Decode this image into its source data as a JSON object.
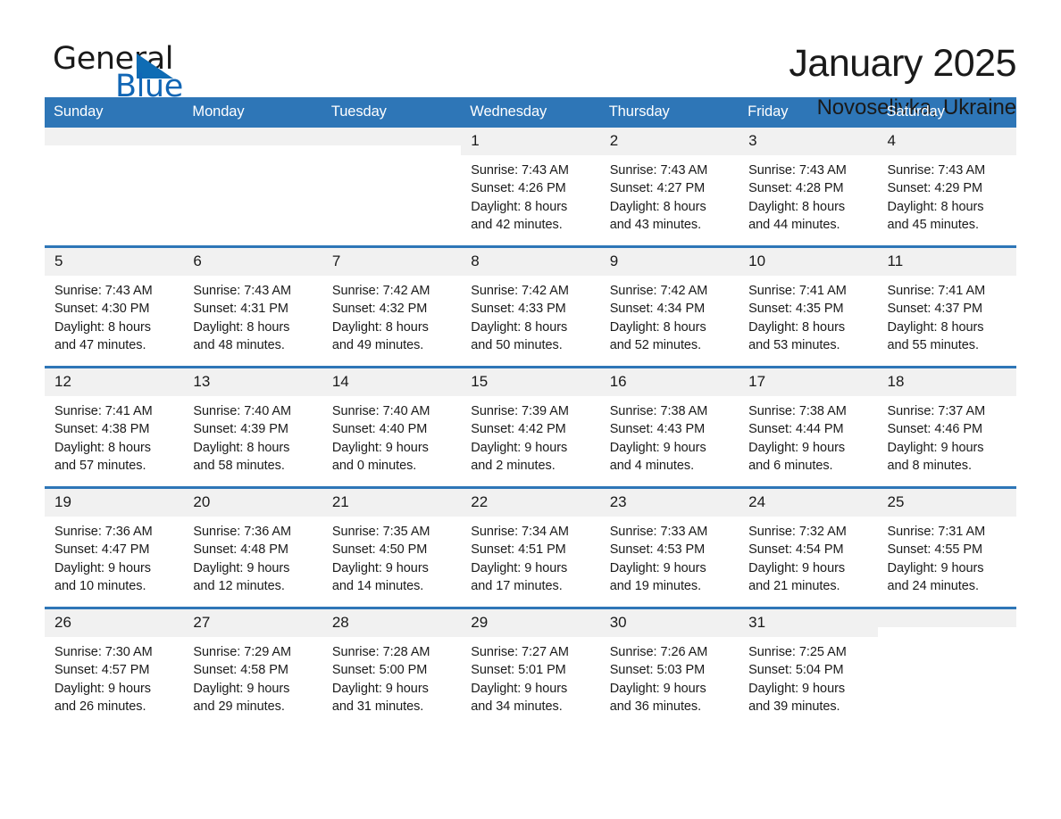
{
  "logo": {
    "word_one": "General",
    "word_two": "Blue",
    "triangle_icon": "triangle-icon"
  },
  "header": {
    "title": "January 2025",
    "location": "Novoselivka, Ukraine"
  },
  "colors": {
    "header_blue": "#2e76b7",
    "daynum_gray": "#f1f1f1",
    "logo_blue": "#1166b5",
    "text": "#1a1a1a"
  },
  "weekday_headers": [
    "Sunday",
    "Monday",
    "Tuesday",
    "Wednesday",
    "Thursday",
    "Friday",
    "Saturday"
  ],
  "weeks": [
    [
      {
        "day": "",
        "empty": true,
        "sunrise": "",
        "sunset": "",
        "daylight_line1": "",
        "daylight_line2": ""
      },
      {
        "day": "",
        "empty": true,
        "sunrise": "",
        "sunset": "",
        "daylight_line1": "",
        "daylight_line2": ""
      },
      {
        "day": "",
        "empty": true,
        "sunrise": "",
        "sunset": "",
        "daylight_line1": "",
        "daylight_line2": ""
      },
      {
        "day": "1",
        "empty": false,
        "sunrise": "Sunrise: 7:43 AM",
        "sunset": "Sunset: 4:26 PM",
        "daylight_line1": "Daylight: 8 hours",
        "daylight_line2": "and 42 minutes."
      },
      {
        "day": "2",
        "empty": false,
        "sunrise": "Sunrise: 7:43 AM",
        "sunset": "Sunset: 4:27 PM",
        "daylight_line1": "Daylight: 8 hours",
        "daylight_line2": "and 43 minutes."
      },
      {
        "day": "3",
        "empty": false,
        "sunrise": "Sunrise: 7:43 AM",
        "sunset": "Sunset: 4:28 PM",
        "daylight_line1": "Daylight: 8 hours",
        "daylight_line2": "and 44 minutes."
      },
      {
        "day": "4",
        "empty": false,
        "sunrise": "Sunrise: 7:43 AM",
        "sunset": "Sunset: 4:29 PM",
        "daylight_line1": "Daylight: 8 hours",
        "daylight_line2": "and 45 minutes."
      }
    ],
    [
      {
        "day": "5",
        "empty": false,
        "sunrise": "Sunrise: 7:43 AM",
        "sunset": "Sunset: 4:30 PM",
        "daylight_line1": "Daylight: 8 hours",
        "daylight_line2": "and 47 minutes."
      },
      {
        "day": "6",
        "empty": false,
        "sunrise": "Sunrise: 7:43 AM",
        "sunset": "Sunset: 4:31 PM",
        "daylight_line1": "Daylight: 8 hours",
        "daylight_line2": "and 48 minutes."
      },
      {
        "day": "7",
        "empty": false,
        "sunrise": "Sunrise: 7:42 AM",
        "sunset": "Sunset: 4:32 PM",
        "daylight_line1": "Daylight: 8 hours",
        "daylight_line2": "and 49 minutes."
      },
      {
        "day": "8",
        "empty": false,
        "sunrise": "Sunrise: 7:42 AM",
        "sunset": "Sunset: 4:33 PM",
        "daylight_line1": "Daylight: 8 hours",
        "daylight_line2": "and 50 minutes."
      },
      {
        "day": "9",
        "empty": false,
        "sunrise": "Sunrise: 7:42 AM",
        "sunset": "Sunset: 4:34 PM",
        "daylight_line1": "Daylight: 8 hours",
        "daylight_line2": "and 52 minutes."
      },
      {
        "day": "10",
        "empty": false,
        "sunrise": "Sunrise: 7:41 AM",
        "sunset": "Sunset: 4:35 PM",
        "daylight_line1": "Daylight: 8 hours",
        "daylight_line2": "and 53 minutes."
      },
      {
        "day": "11",
        "empty": false,
        "sunrise": "Sunrise: 7:41 AM",
        "sunset": "Sunset: 4:37 PM",
        "daylight_line1": "Daylight: 8 hours",
        "daylight_line2": "and 55 minutes."
      }
    ],
    [
      {
        "day": "12",
        "empty": false,
        "sunrise": "Sunrise: 7:41 AM",
        "sunset": "Sunset: 4:38 PM",
        "daylight_line1": "Daylight: 8 hours",
        "daylight_line2": "and 57 minutes."
      },
      {
        "day": "13",
        "empty": false,
        "sunrise": "Sunrise: 7:40 AM",
        "sunset": "Sunset: 4:39 PM",
        "daylight_line1": "Daylight: 8 hours",
        "daylight_line2": "and 58 minutes."
      },
      {
        "day": "14",
        "empty": false,
        "sunrise": "Sunrise: 7:40 AM",
        "sunset": "Sunset: 4:40 PM",
        "daylight_line1": "Daylight: 9 hours",
        "daylight_line2": "and 0 minutes."
      },
      {
        "day": "15",
        "empty": false,
        "sunrise": "Sunrise: 7:39 AM",
        "sunset": "Sunset: 4:42 PM",
        "daylight_line1": "Daylight: 9 hours",
        "daylight_line2": "and 2 minutes."
      },
      {
        "day": "16",
        "empty": false,
        "sunrise": "Sunrise: 7:38 AM",
        "sunset": "Sunset: 4:43 PM",
        "daylight_line1": "Daylight: 9 hours",
        "daylight_line2": "and 4 minutes."
      },
      {
        "day": "17",
        "empty": false,
        "sunrise": "Sunrise: 7:38 AM",
        "sunset": "Sunset: 4:44 PM",
        "daylight_line1": "Daylight: 9 hours",
        "daylight_line2": "and 6 minutes."
      },
      {
        "day": "18",
        "empty": false,
        "sunrise": "Sunrise: 7:37 AM",
        "sunset": "Sunset: 4:46 PM",
        "daylight_line1": "Daylight: 9 hours",
        "daylight_line2": "and 8 minutes."
      }
    ],
    [
      {
        "day": "19",
        "empty": false,
        "sunrise": "Sunrise: 7:36 AM",
        "sunset": "Sunset: 4:47 PM",
        "daylight_line1": "Daylight: 9 hours",
        "daylight_line2": "and 10 minutes."
      },
      {
        "day": "20",
        "empty": false,
        "sunrise": "Sunrise: 7:36 AM",
        "sunset": "Sunset: 4:48 PM",
        "daylight_line1": "Daylight: 9 hours",
        "daylight_line2": "and 12 minutes."
      },
      {
        "day": "21",
        "empty": false,
        "sunrise": "Sunrise: 7:35 AM",
        "sunset": "Sunset: 4:50 PM",
        "daylight_line1": "Daylight: 9 hours",
        "daylight_line2": "and 14 minutes."
      },
      {
        "day": "22",
        "empty": false,
        "sunrise": "Sunrise: 7:34 AM",
        "sunset": "Sunset: 4:51 PM",
        "daylight_line1": "Daylight: 9 hours",
        "daylight_line2": "and 17 minutes."
      },
      {
        "day": "23",
        "empty": false,
        "sunrise": "Sunrise: 7:33 AM",
        "sunset": "Sunset: 4:53 PM",
        "daylight_line1": "Daylight: 9 hours",
        "daylight_line2": "and 19 minutes."
      },
      {
        "day": "24",
        "empty": false,
        "sunrise": "Sunrise: 7:32 AM",
        "sunset": "Sunset: 4:54 PM",
        "daylight_line1": "Daylight: 9 hours",
        "daylight_line2": "and 21 minutes."
      },
      {
        "day": "25",
        "empty": false,
        "sunrise": "Sunrise: 7:31 AM",
        "sunset": "Sunset: 4:55 PM",
        "daylight_line1": "Daylight: 9 hours",
        "daylight_line2": "and 24 minutes."
      }
    ],
    [
      {
        "day": "26",
        "empty": false,
        "sunrise": "Sunrise: 7:30 AM",
        "sunset": "Sunset: 4:57 PM",
        "daylight_line1": "Daylight: 9 hours",
        "daylight_line2": "and 26 minutes."
      },
      {
        "day": "27",
        "empty": false,
        "sunrise": "Sunrise: 7:29 AM",
        "sunset": "Sunset: 4:58 PM",
        "daylight_line1": "Daylight: 9 hours",
        "daylight_line2": "and 29 minutes."
      },
      {
        "day": "28",
        "empty": false,
        "sunrise": "Sunrise: 7:28 AM",
        "sunset": "Sunset: 5:00 PM",
        "daylight_line1": "Daylight: 9 hours",
        "daylight_line2": "and 31 minutes."
      },
      {
        "day": "29",
        "empty": false,
        "sunrise": "Sunrise: 7:27 AM",
        "sunset": "Sunset: 5:01 PM",
        "daylight_line1": "Daylight: 9 hours",
        "daylight_line2": "and 34 minutes."
      },
      {
        "day": "30",
        "empty": false,
        "sunrise": "Sunrise: 7:26 AM",
        "sunset": "Sunset: 5:03 PM",
        "daylight_line1": "Daylight: 9 hours",
        "daylight_line2": "and 36 minutes."
      },
      {
        "day": "31",
        "empty": false,
        "sunrise": "Sunrise: 7:25 AM",
        "sunset": "Sunset: 5:04 PM",
        "daylight_line1": "Daylight: 9 hours",
        "daylight_line2": "and 39 minutes."
      },
      {
        "day": "",
        "empty": true,
        "sunrise": "",
        "sunset": "",
        "daylight_line1": "",
        "daylight_line2": ""
      }
    ]
  ]
}
